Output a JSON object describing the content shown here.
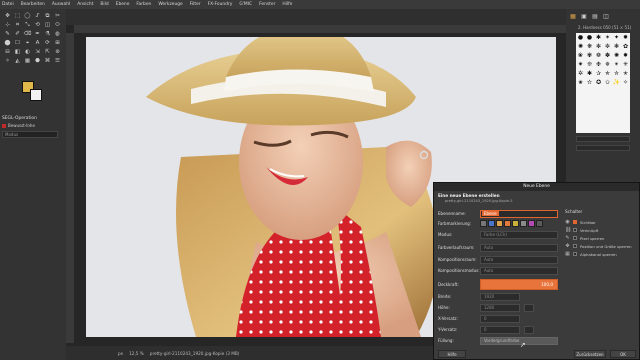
{
  "menu": [
    "Datei",
    "Bearbeiten",
    "Auswahl",
    "Ansicht",
    "Bild",
    "Ebene",
    "Farben",
    "Werkzeuge",
    "Filter",
    "FX-Foundry",
    "G'MIC",
    "Fenster",
    "Hilfe"
  ],
  "toolbox": {
    "tool_icons": [
      "✥",
      "⬚",
      "◯",
      "ᔑ",
      "⧉",
      "✂",
      "⊹",
      "⌗",
      "⤡",
      "⟲",
      "◫",
      "⬭",
      "✎",
      "✐",
      "⌫",
      "✒",
      "⚗",
      "◍",
      "⬤",
      "☐",
      "⌖",
      "A",
      "⟳",
      "⊞",
      "⊟",
      "◧",
      "◐",
      "⇲",
      "⇱",
      "⊛",
      "✧",
      "◭",
      "▦",
      "⬣",
      "⌘",
      "☰"
    ],
    "options_title": "SEGL-Operation",
    "options_check": "Bewusst-Inhe",
    "options_select": "Modus"
  },
  "status": {
    "unit": "px",
    "zoom": "12,5 %",
    "file": "pretty-girl-2110243_1920.jpg-Kopie (3 MB)"
  },
  "dock": {
    "tab_icons": [
      "▦",
      "▣",
      "▤",
      "◫"
    ],
    "brush_name": "2. Hardness 050 (51 × 51)",
    "brush_glyphs": [
      "●",
      "●",
      "✱",
      "✶",
      "✦",
      "✹",
      "✺",
      "❋",
      "✻",
      "✼",
      "❃",
      "✿",
      "❀",
      "✾",
      "❁",
      "✽",
      "✺",
      "✸",
      "✷",
      "❊",
      "❉",
      "✵",
      "✴",
      "✳",
      "✲",
      "✱",
      "✰",
      "✯",
      "✮",
      "✭",
      "✬",
      "✫",
      "✪",
      "✩",
      "✨",
      "✧"
    ]
  },
  "dialog": {
    "title": "Neue Ebene",
    "heading": "Eine neue Ebene erstellen",
    "subheading": "pretty-girl-2110243_1920.jpg-Kopie-5",
    "name_label": "Ebenenname:",
    "name_value": "Ebene",
    "color_tag_label": "Farbmarkierung:",
    "color_tags": [
      "#777777",
      "#4a74c9",
      "#e0a24a",
      "#e07a3a",
      "#c8b23a",
      "#8a8a8a",
      "#b44bb4",
      "#5a5a5a"
    ],
    "mode_label": "Modus:",
    "mode_value": "Farbe (LCh)",
    "blend_label": "Farbverlaufsraum:",
    "blend_value": "Auto",
    "comp_space_label": "Kompositionsraum:",
    "comp_space_value": "Auto",
    "comp_mode_label": "Kompositionsmodus:",
    "comp_mode_value": "Auto",
    "opacity_label": "Deckkraft:",
    "opacity_value": "100,0",
    "width_label": "Breite:",
    "width_value": "1920",
    "height_label": "Höhe:",
    "height_value": "1280",
    "offx_label": "X-Versatz:",
    "offx_value": "0",
    "offy_label": "Y-Versatz:",
    "offy_value": "0",
    "fill_label": "Füllung:",
    "fill_value": "Vordergrundfarbe",
    "switches_title": "Schalter",
    "switches": [
      {
        "label": "Sichtbar",
        "on": true,
        "icon": "◉"
      },
      {
        "label": "Verknüpft",
        "on": false,
        "icon": "⛓"
      },
      {
        "label": "Pixel sperren",
        "on": false,
        "icon": "✎"
      },
      {
        "label": "Position und Größe sperren",
        "on": false,
        "icon": "✥"
      },
      {
        "label": "Alphakanal sperren",
        "on": false,
        "icon": "▦"
      }
    ],
    "help_button": "Hilfe",
    "reset_button": "Zurücksetzen",
    "ok_button": "OK"
  }
}
